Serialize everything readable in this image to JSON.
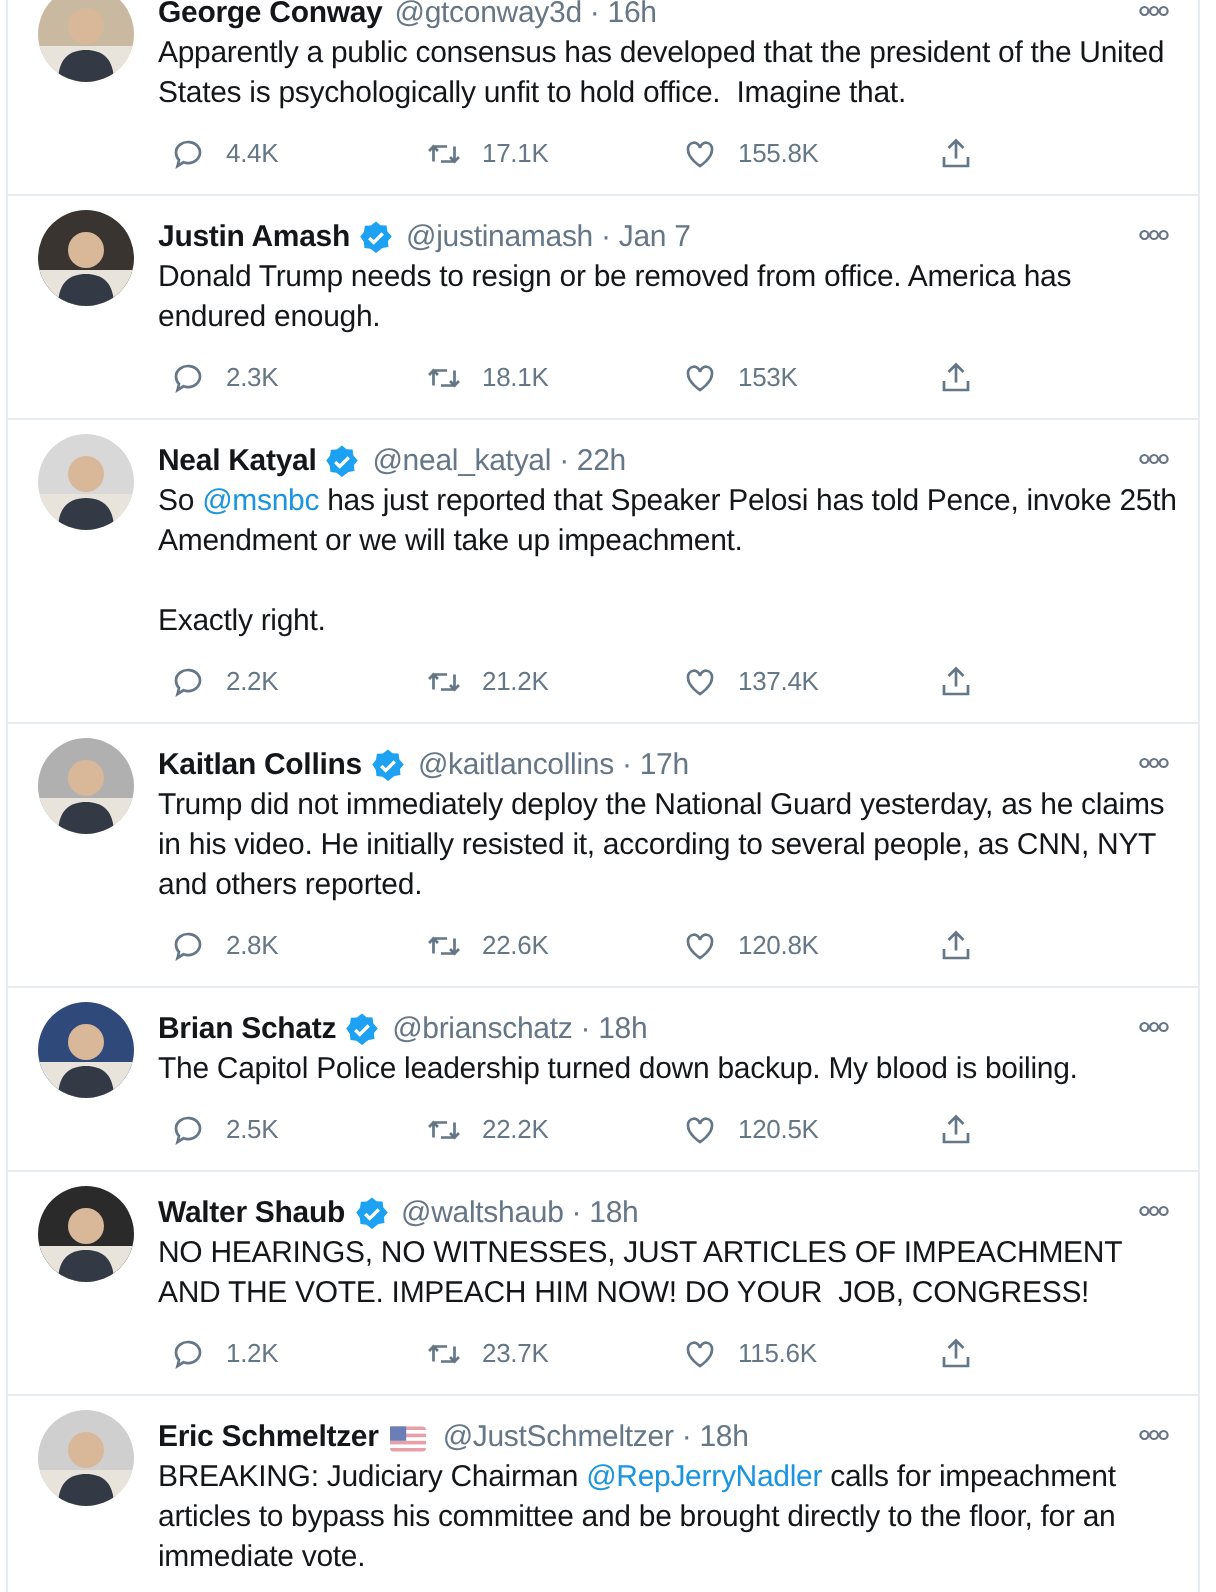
{
  "tweets": [
    {
      "name": "George Conway",
      "verified": false,
      "meta": "@gtconway3d · 16h",
      "paragraphs": [
        [
          {
            "text": "Apparently a public consensus has developed that the president of the United States is psychologically unfit to hold office.  Imagine that."
          }
        ]
      ],
      "replies": "4.4K",
      "retweets": "17.1K",
      "likes": "155.8K"
    },
    {
      "name": "Justin Amash",
      "verified": true,
      "meta": "@justinamash · Jan 7",
      "paragraphs": [
        [
          {
            "text": "Donald Trump needs to resign or be removed from office. America has endured enough."
          }
        ]
      ],
      "replies": "2.3K",
      "retweets": "18.1K",
      "likes": "153K"
    },
    {
      "name": "Neal Katyal",
      "verified": true,
      "meta": "@neal_katyal · 22h",
      "paragraphs": [
        [
          {
            "text": "So "
          },
          {
            "text": "@msnbc",
            "kind": "mention"
          },
          {
            "text": " has just reported that Speaker Pelosi has told Pence, invoke 25th Amendment or we will take up impeachment."
          }
        ],
        [
          {
            "text": "Exactly right."
          }
        ]
      ],
      "replies": "2.2K",
      "retweets": "21.2K",
      "likes": "137.4K"
    },
    {
      "name": "Kaitlan Collins",
      "verified": true,
      "meta": "@kaitlancollins · 17h",
      "paragraphs": [
        [
          {
            "text": "Trump did not immediately deploy the National Guard yesterday, as he claims in his video. He initially resisted it, according to several people, as CNN, NYT and others reported."
          }
        ]
      ],
      "replies": "2.8K",
      "retweets": "22.6K",
      "likes": "120.8K"
    },
    {
      "name": "Brian Schatz",
      "verified": true,
      "meta": "@brianschatz · 18h",
      "paragraphs": [
        [
          {
            "text": "The Capitol Police leadership turned down backup. My blood is boiling."
          }
        ]
      ],
      "replies": "2.5K",
      "retweets": "22.2K",
      "likes": "120.5K"
    },
    {
      "name": "Walter Shaub",
      "verified": true,
      "meta": "@waltshaub · 18h",
      "paragraphs": [
        [
          {
            "text": "NO HEARINGS, NO WITNESSES, JUST ARTICLES OF IMPEACHMENT AND THE VOTE. IMPEACH HIM NOW! DO YOUR  JOB, CONGRESS!"
          }
        ]
      ],
      "replies": "1.2K",
      "retweets": "23.7K",
      "likes": "115.6K"
    },
    {
      "name": "Eric Schmeltzer",
      "verified": false,
      "flag": true,
      "meta": "@JustSchmeltzer · 18h",
      "paragraphs": [
        [
          {
            "text": "BREAKING: Judiciary Chairman "
          },
          {
            "text": "@RepJerryNadler",
            "kind": "mention"
          },
          {
            "text": " calls for impeachment articles to bypass his committee and be brought directly to the floor, for an immediate vote."
          }
        ]
      ]
    }
  ]
}
